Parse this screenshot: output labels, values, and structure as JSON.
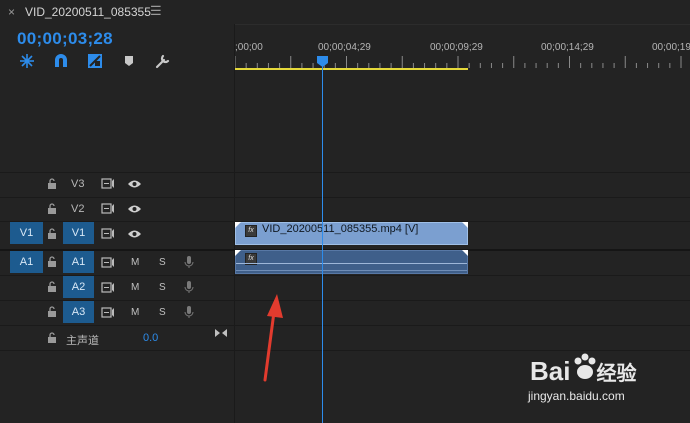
{
  "tab": {
    "close_glyph": "×",
    "title": "VID_20200511_085355",
    "menu_glyph": "☰"
  },
  "timecode": "00;00;03;28",
  "ruler": {
    "labels": [
      ";00;00",
      "00;00;04;29",
      "00;00;09;29",
      "00;00;14;29",
      "00;00;19"
    ]
  },
  "video_tracks": [
    {
      "name": "V3",
      "source": ""
    },
    {
      "name": "V2",
      "source": ""
    },
    {
      "name": "V1",
      "source": "V1"
    }
  ],
  "audio_tracks": [
    {
      "name": "A1",
      "source": "A1",
      "m": "M",
      "s": "S"
    },
    {
      "name": "A2",
      "source": "",
      "m": "M",
      "s": "S"
    },
    {
      "name": "A3",
      "source": "",
      "m": "M",
      "s": "S"
    }
  ],
  "master": {
    "label": "主声道",
    "value": "0.0"
  },
  "clips": {
    "video_name": "VID_20200511_085355.mp4 [V]",
    "fx_badge": "fx"
  },
  "watermark": {
    "brand": "Bai",
    "brand2": "经验",
    "url": "jingyan.baidu.com"
  },
  "colors": {
    "accent": "#2d8ceb",
    "target": "#1d5b8f",
    "video_clip": "#7b9fd0",
    "audio_clip": "#3f5f8a",
    "work_area": "#e4d83a"
  }
}
